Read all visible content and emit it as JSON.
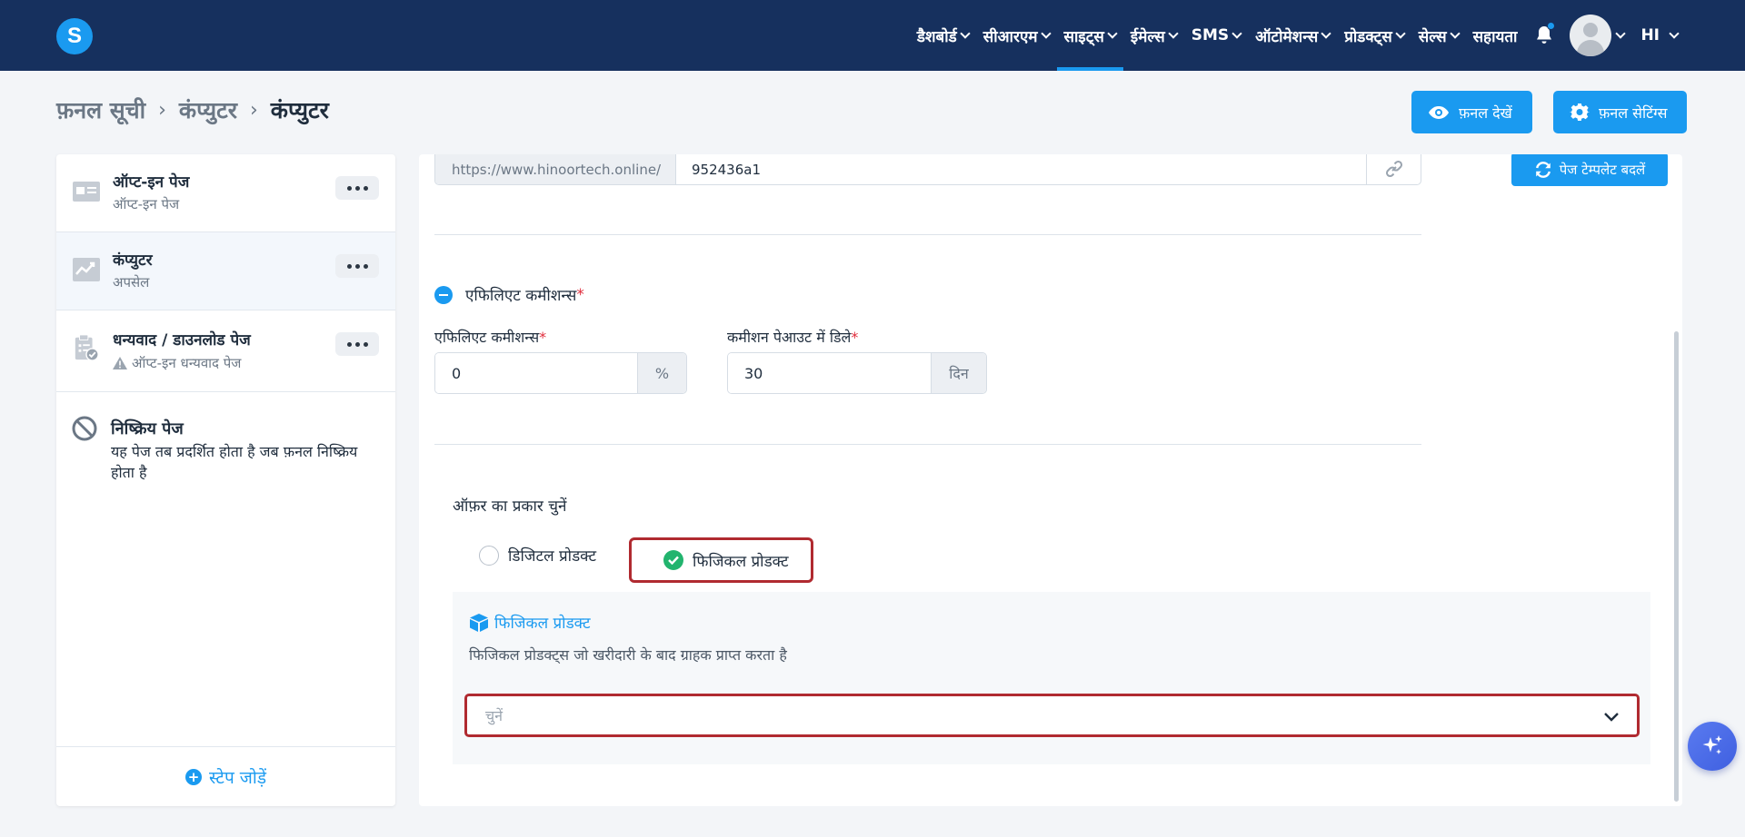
{
  "nav": {
    "logo": "S",
    "items": [
      {
        "label": "डैशबोर्ड"
      },
      {
        "label": "सीआरएम"
      },
      {
        "label": "साइट्स"
      },
      {
        "label": "ईमेल्स"
      },
      {
        "label": "SMS"
      },
      {
        "label": "ऑटोमेशन्स"
      },
      {
        "label": "प्रोडक्ट्स"
      },
      {
        "label": "सेल्स"
      }
    ],
    "active_index": 2,
    "help": "सहायता",
    "language": "HI",
    "accent_color": "#1a9af0",
    "bar_color": "#16305e"
  },
  "header": {
    "breadcrumb": [
      "फ़नल सूची",
      "कंप्युटर",
      "कंप्युटर"
    ],
    "view_funnel": "फ़नल देखें",
    "funnel_settings": "फ़नल सेटिंग्स"
  },
  "sidebar": {
    "steps": [
      {
        "title": "ऑप्ट-इन पेज",
        "subtitle": "ऑप्ट-इन पेज",
        "icon": "optin-form-icon"
      },
      {
        "title": "कंप्युटर",
        "subtitle": "अपसेल",
        "icon": "upsell-chart-icon"
      },
      {
        "title": "धन्यवाद / डाउनलोड पेज",
        "subtitle": "ऑप्ट-इन धन्यवाद पेज",
        "icon": "clipboard-check-icon"
      }
    ],
    "inactive": {
      "title": "निष्क्रिय पेज",
      "description": "यह पेज तब प्रदर्शित होता है जब फ़नल निष्क्रिय होता है"
    },
    "add_step": "स्टेप जोड़ें"
  },
  "main": {
    "change_template": "पेज टेम्पलेट बदलें",
    "url_prefix": "https://www.hinoortech.online/",
    "url_slug": "952436a1",
    "affiliate_section": "एफिलिएट कमीशन्स",
    "commission_label": "एफिलिएट कमीशन्स",
    "commission_value": "0",
    "commission_unit": "%",
    "payout_delay_label": "कमीशन पेआउट में डिले",
    "payout_delay_value": "30",
    "payout_delay_unit": "दिन",
    "offer_type_label": "ऑफ़र का प्रकार चुनें",
    "offer_options": [
      "डिजिटल प्रोडक्ट",
      "फिजिकल प्रोडक्ट"
    ],
    "selected_offer": "फिजिकल प्रोडक्ट",
    "physical_title": "फिजिकल प्रोडक्ट",
    "physical_desc": "फिजिकल प्रोडक्ट्स जो खरीदारी के बाद ग्राहक प्राप्त करता है",
    "select_placeholder": "चुनें"
  }
}
